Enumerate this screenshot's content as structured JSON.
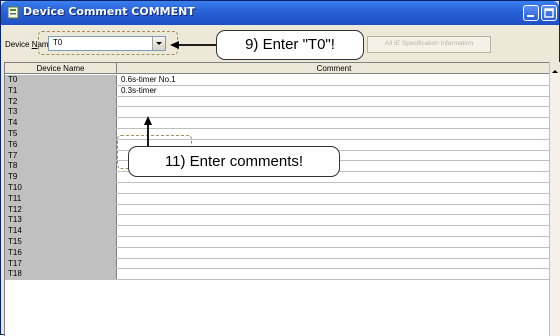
{
  "window": {
    "title": "Device Comment COMMENT"
  },
  "toolbar": {
    "device_name_label_prefix": "Device ",
    "device_name_label_accel": "N",
    "device_name_label_suffix": "ame",
    "device_name_value": "T0",
    "spec_button_label": "All IE Specification Information"
  },
  "grid": {
    "headers": {
      "device_name": "Device Name",
      "comment": "Comment"
    },
    "rows": [
      {
        "name": "T0",
        "comment": "0.6s-timer No.1"
      },
      {
        "name": "T1",
        "comment": "0.3s-timer"
      },
      {
        "name": "T2",
        "comment": ""
      },
      {
        "name": "T3",
        "comment": ""
      },
      {
        "name": "T4",
        "comment": ""
      },
      {
        "name": "T5",
        "comment": ""
      },
      {
        "name": "T6",
        "comment": ""
      },
      {
        "name": "T7",
        "comment": ""
      },
      {
        "name": "T8",
        "comment": ""
      },
      {
        "name": "T9",
        "comment": ""
      },
      {
        "name": "T10",
        "comment": ""
      },
      {
        "name": "T11",
        "comment": ""
      },
      {
        "name": "T12",
        "comment": ""
      },
      {
        "name": "T13",
        "comment": ""
      },
      {
        "name": "T14",
        "comment": ""
      },
      {
        "name": "T15",
        "comment": ""
      },
      {
        "name": "T16",
        "comment": ""
      },
      {
        "name": "T17",
        "comment": ""
      },
      {
        "name": "T18",
        "comment": ""
      }
    ]
  },
  "callouts": {
    "step9": "9) Enter \"T0\"!",
    "step11": "11) Enter comments!"
  },
  "icons": {
    "app": "app-icon",
    "minimize": "minimize-icon",
    "maximize": "maximize-icon",
    "dropdown": "chevron-down-icon",
    "scroll_up": "scroll-up-icon"
  }
}
